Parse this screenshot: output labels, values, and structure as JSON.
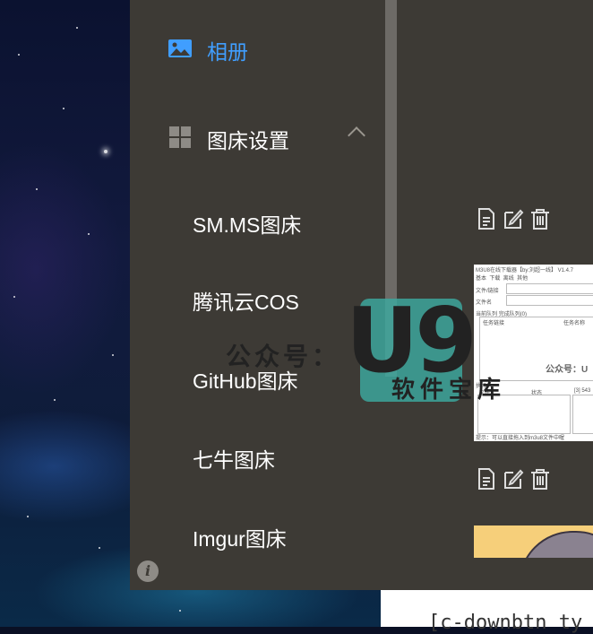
{
  "sidebar": {
    "items": [
      {
        "label": "相册",
        "icon": "image-icon",
        "active": true
      },
      {
        "label": "图床设置",
        "icon": "grid-icon",
        "expanded": true
      },
      {
        "label": "SM.MS图床"
      },
      {
        "label": "腾讯云COS"
      },
      {
        "label": "GitHub图床"
      },
      {
        "label": "七牛图床"
      },
      {
        "label": "Imgur图床"
      }
    ],
    "info_icon": "info-icon"
  },
  "content": {
    "code_text": "[c-downbtn ty",
    "thumbnail": {
      "title": "M3U8在线下载器【by:刘超一线】 V1.4.7",
      "menu": [
        "基本",
        "下载",
        "离线",
        "其他"
      ],
      "field1": "文件/链接",
      "field2": "文件名",
      "tabs": [
        "当前队列",
        "完成队列(0)"
      ],
      "col1": "任务链接",
      "col2": "任务名称",
      "watermark": "公众号：U",
      "section": "执行",
      "label_file": "文件",
      "label_status": "状态",
      "label_count": "[3] 543",
      "status_bar": "提示：可以直接拖入到m3u8文件中喔"
    }
  },
  "watermark": {
    "gzh": "公众号：",
    "u9": "U9",
    "soft": "软件宝库"
  },
  "colors": {
    "sidebar_bg": "#3d3a35",
    "active": "#409eff"
  }
}
